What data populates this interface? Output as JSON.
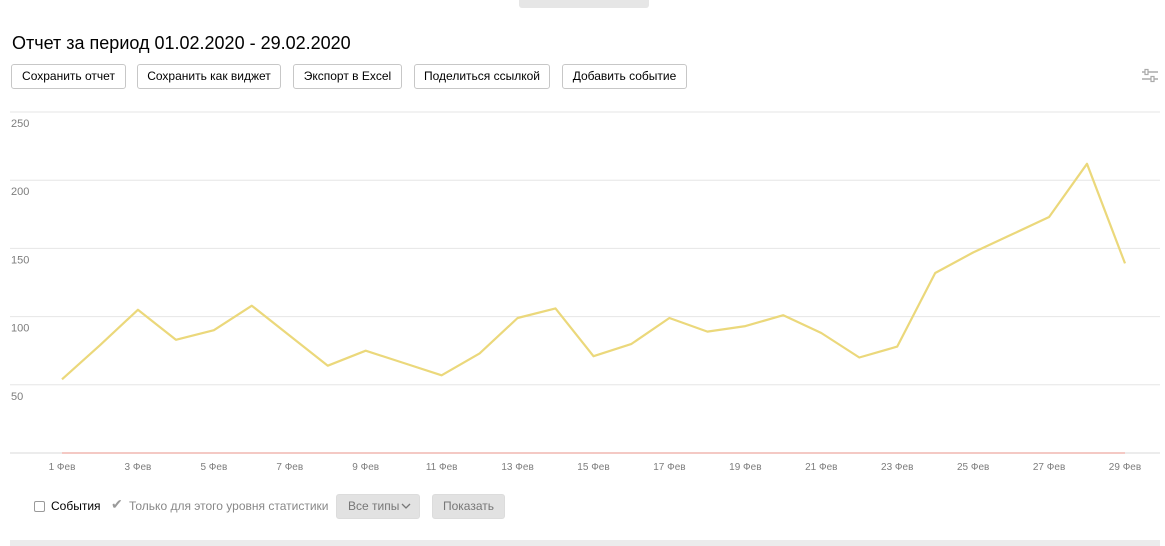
{
  "report": {
    "title": "Отчет за период 01.02.2020 - 29.02.2020"
  },
  "toolbar": {
    "save_report": "Сохранить отчет",
    "save_widget": "Сохранить как виджет",
    "export_excel": "Экспорт в Excel",
    "share_link": "Поделиться ссылкой",
    "add_event": "Добавить событие"
  },
  "controls": {
    "events_label": "События",
    "events_checked": false,
    "level_only_label": "Только для этого уровня статистики",
    "level_only_checked": true,
    "types_select": "Все типы",
    "show_button": "Показать"
  },
  "icons": {
    "settings": "sliders-icon",
    "dropdown": "chevron-down-icon",
    "check": "check-icon"
  },
  "chart_data": {
    "type": "line",
    "x": [
      "1 Фев",
      "2 Фев",
      "3 Фев",
      "4 Фев",
      "5 Фев",
      "6 Фев",
      "7 Фев",
      "8 Фев",
      "9 Фев",
      "10 Фев",
      "11 Фев",
      "12 Фев",
      "13 Фев",
      "14 Фев",
      "15 Фев",
      "16 Фев",
      "17 Фев",
      "18 Фев",
      "19 Фев",
      "20 Фев",
      "21 Фев",
      "22 Фев",
      "23 Фев",
      "24 Фев",
      "25 Фев",
      "26 Фев",
      "27 Фев",
      "28 Фев",
      "29 Фев"
    ],
    "xticks": [
      "1 Фев",
      "3 Фев",
      "5 Фев",
      "7 Фев",
      "9 Фев",
      "11 Фев",
      "13 Фев",
      "15 Фев",
      "17 Фев",
      "19 Фев",
      "21 Фев",
      "23 Фев",
      "25 Фев",
      "27 Фев",
      "29 Фев"
    ],
    "yticks": [
      50,
      100,
      150,
      200,
      250
    ],
    "ylim": [
      0,
      250
    ],
    "grid": true,
    "series": [
      {
        "color": "#ebd87b",
        "values": [
          54,
          79,
          105,
          83,
          90,
          108,
          86,
          64,
          75,
          66,
          57,
          73,
          99,
          106,
          71,
          80,
          99,
          89,
          93,
          101,
          88,
          70,
          78,
          132,
          147,
          160,
          173,
          212,
          139
        ]
      },
      {
        "color": "#f1b7b0",
        "values": [
          0,
          0,
          0,
          0,
          0,
          0,
          0,
          0,
          0,
          0,
          0,
          0,
          0,
          0,
          0,
          0,
          0,
          0,
          0,
          0,
          0,
          0,
          0,
          0,
          0,
          0,
          0,
          0,
          0
        ]
      }
    ]
  }
}
